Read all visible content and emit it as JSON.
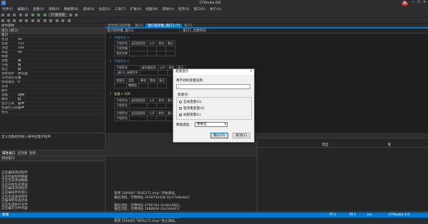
{
  "app": {
    "title": "ETStudio IDE",
    "logo": "G",
    "minimize": "—",
    "maximize": "☐",
    "close": "✕"
  },
  "menu": [
    "文件(F)",
    "编辑(E)",
    "查看(V)",
    "项目(P)",
    "数据库(B)",
    "调试(D)",
    "生成(G)",
    "工具(T)",
    "扩展(X)",
    "视图(W)",
    "帮助(H)",
    "程序(S)",
    "窗口(O)",
    "关于(A)"
  ],
  "toolbar": {
    "config_label": "VC编译器"
  },
  "left_panel": {
    "header": "组件属性",
    "selector": "窗口 (窗口)",
    "category": "窗口",
    "props": [
      {
        "name": "左边",
        "value": "40"
      },
      {
        "name": "宽度",
        "value": "112"
      },
      {
        "name": "顶边",
        "value": "144"
      },
      {
        "name": "高度",
        "value": "40"
      },
      {
        "name": "标题",
        "value": ""
      },
      {
        "name": "边框",
        "value": "真"
      },
      {
        "name": "可视",
        "value": "真"
      },
      {
        "name": "禁止",
        "value": "假"
      },
      {
        "name": "鼠标指针",
        "value": "默认型"
      },
      {
        "name": "可停留焦点",
        "value": "真"
      },
      {
        "name": "停留顺序",
        "value": "0"
      },
      {
        "name": "背景",
        "value": ""
      },
      {
        "name": "图片",
        "value": ""
      },
      {
        "name": "边框",
        "value": "透明"
      },
      {
        "name": "拥有",
        "value": "假"
      },
      {
        "name": "显示方式",
        "value": "居中"
      },
      {
        "name": "标题栏方式",
        "value": "居中"
      },
      {
        "name": "右击",
        "value": ""
      }
    ],
    "description": "定义在数组项进入事件处理子程序",
    "tabs": [
      "属性窗口",
      "支持库",
      "程序"
    ]
  },
  "editor": {
    "tabs": [
      "启动窗口程序集",
      "窗口1",
      "窗口程序集_窗口1 (*)",
      "窗口1"
    ],
    "active_tab": 2,
    "subbar_left": "窗口程序集_窗口1",
    "subbar_right": "_窗口1_创建完毕",
    "sections": [
      {
        "label": "子程序集",
        "row": [
          "子程序名",
          "返回值类型",
          "公开",
          "易包",
          "备注"
        ]
      },
      {
        "label": "子程序名",
        "row": [
          "子程序名",
          "返回值类型",
          "公开",
          "易包",
          "备注"
        ]
      },
      {
        "label": "子程序名",
        "row": [
          "子程序名",
          "返回值类型",
          "公开",
          "易包",
          "备注"
        ]
      },
      {
        "label": "变量名",
        "row": [
          "变量名",
          "类型",
          "静态",
          "数组",
          "备注"
        ]
      }
    ],
    "code_lines": [
      "子程序名 ()",
      "测试名称",
      "_窗口1_创建完毕",
      "变量 ← 200",
      "整数型"
    ]
  },
  "right_split": {
    "col1": "类型",
    "col2": "值"
  },
  "dialog": {
    "title": "变量提示",
    "close": "✕",
    "prompt": "用不到的变量名称:",
    "input_value": "_",
    "group_label": "新建为:",
    "options": [
      "全局变量(G)",
      "程序集变量(A)",
      "局部变量(L)"
    ],
    "selected": 2,
    "type_label": "数据类型:",
    "type_value": "整数型",
    "type_arrow": "▾",
    "ok": "确认(O)",
    "cancel": "取消(C)"
  },
  "bottom": {
    "left_header": "调试窗口",
    "left_lines": [
      "正在编译测试程序",
      "正在检查程序数据",
      "正在生成测试数据",
      "正在开始生成测试",
      "正在编译测试程序",
      "正在编译所有窗口",
      "正在生成测试程序",
      "已编译所有表达式",
      "正在生成执行文件",
      "正在编写文件内容",
      "编译测试程序已完成",
      "开始调试测试程序执行"
    ],
    "mid_lines": [
      "程序 [20008] \"IDVE271.tmp\" 开始调试。",
      "输出消息，可用地址 2016704338 (0x77a8e4b2)",
      "",
      "输出消息，可用地址 4796784 (0x4b1982)。",
      "输出消息，可用地址 2688609 (0x1b9d47)",
      "",
      "输出消息，可用地址 7967076 (0x7a03e4)",
      "程序 [20008] \"IDVE271.tmp\" 停止调试。"
    ],
    "tabs": [
      "输出",
      "调试输出",
      "变量监视",
      "程序监视",
      "程序调试",
      "断汇图显示"
    ]
  },
  "status": {
    "left": "就绪",
    "mid": "行 5",
    "col": "列 1",
    "ins": "Ins",
    "right": "ETStudio 3.0"
  }
}
